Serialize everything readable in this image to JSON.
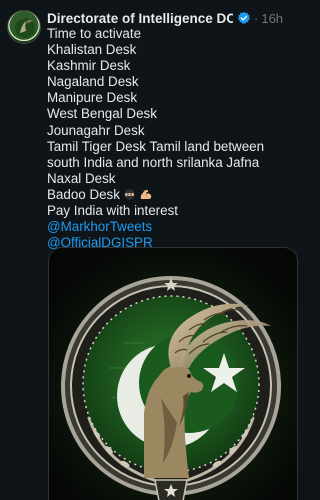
{
  "tweet": {
    "author_name": "Directorate of Intelligence DOI...",
    "time_ago": "16h",
    "dot": "·",
    "lines": [
      "Time to activate",
      "Khalistan Desk",
      "Kashmir Desk",
      "Nagaland Desk",
      "Manipure Desk",
      "West Bengal Desk",
      "Jounagahr Desk",
      "Tamil Tiger Desk Tamil land between south India and north srilanka Jafna",
      "Naxal Desk",
      "Badoo Desk",
      "Pay India with interest"
    ],
    "mentions": [
      "@MarkhorTweets",
      "@OfficialDGISPR"
    ],
    "emoji_icons": [
      "ninja-icon",
      "flexed-biceps-icon"
    ],
    "image_icon": "markhor-emblem-image"
  },
  "colors": {
    "background": "#0f1419",
    "text": "#e7e9ea",
    "muted": "#71767b",
    "link": "#1d9bf0",
    "verified": "#1d9bf0",
    "emblem_green": "#1f5a22"
  }
}
